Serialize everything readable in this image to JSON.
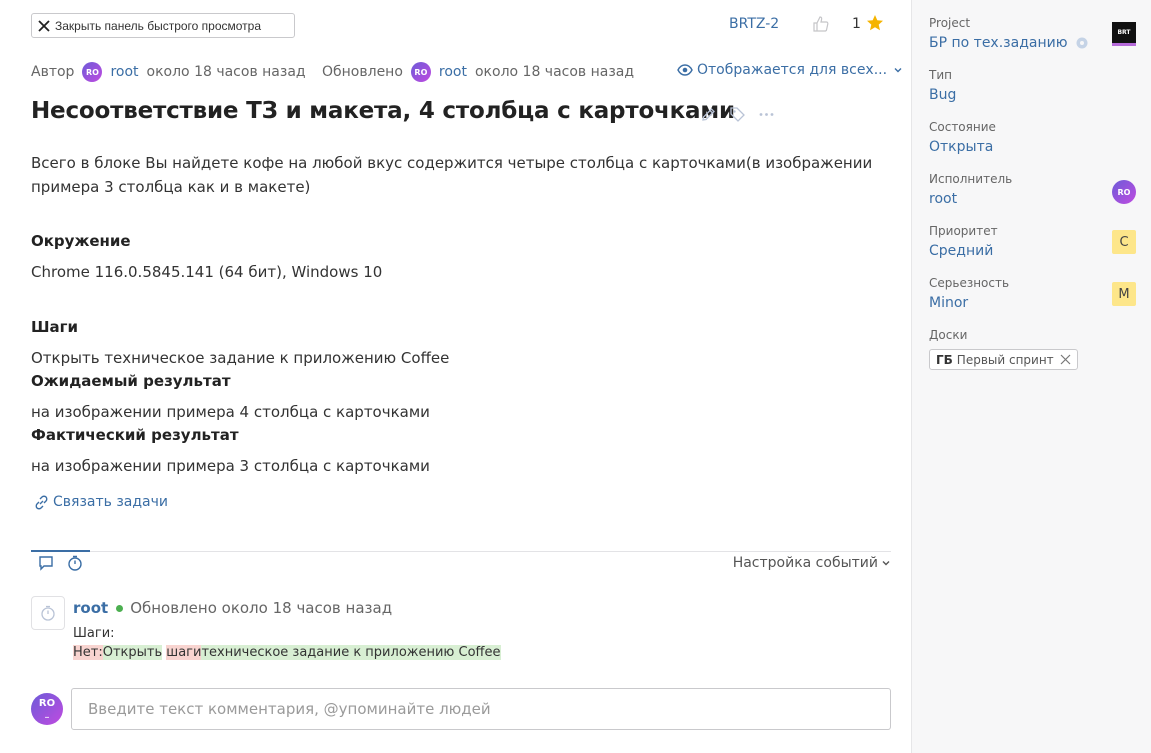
{
  "header": {
    "close_label": "Закрыть панель быстрого просмотра",
    "issue_key": "BRTZ-2",
    "favorites_count": "1"
  },
  "meta": {
    "author_label": "Автор",
    "author_avatar": "RO",
    "author_name": "root",
    "author_time": "около 18 часов назад",
    "updated_label": "Обновлено",
    "updated_avatar": "RO",
    "updated_name": "root",
    "updated_time": "около 18 часов назад",
    "visibility": "Отображается для всех..."
  },
  "issue": {
    "title": "Несоответствие ТЗ и макета, 4 столбца с карточками",
    "description": "Всего в блоке Вы найдете кофе на любой вкус содержится четыре столбца с карточками(в изображении примера 3 столбца как и в макете)",
    "env_heading": "Окружение",
    "env_text": "Chrome 116.0.5845.141 (64 бит), Windows 10",
    "steps_heading": "Шаги",
    "steps_text": "Открыть техническое задание к приложению Coffee",
    "expected_heading": "Ожидаемый результат",
    "expected_text": "на изображении примера 4 столбца с карточками",
    "actual_heading": "Фактический результат",
    "actual_text": "на изображении примера 3 столбца с карточками",
    "link_tasks": "Связать задачи"
  },
  "activity": {
    "events_settings": "Настройка событий",
    "event": {
      "user": "root",
      "text": "Обновлено около 18 часов назад",
      "field": "Шаги:",
      "diff_del_1": "Нет:",
      "diff_ins_1": "Открыть",
      "diff_plain": " ",
      "diff_del_2": "шаги",
      "diff_ins_2": "техническое задание к приложению Coffee"
    },
    "comment_avatar": "RO",
    "comment_placeholder": "Введите текст комментария, @упоминайте людей"
  },
  "sidebar": {
    "project_label": "Project",
    "project_value": "БР по тех.заданию",
    "project_logo": "BRT",
    "type_label": "Тип",
    "type_value": "Bug",
    "state_label": "Состояние",
    "state_value": "Открыта",
    "assignee_label": "Исполнитель",
    "assignee_value": "root",
    "assignee_avatar": "RO",
    "priority_label": "Приоритет",
    "priority_value": "Средний",
    "priority_badge": "C",
    "severity_label": "Серьезность",
    "severity_value": "Minor",
    "severity_badge": "M",
    "boards_label": "Доски",
    "board_code": "ГБ",
    "board_name": "Первый спринт"
  },
  "colors": {
    "link": "#3b6ea5",
    "accent_star": "#f5b400",
    "status_online": "#4caf50",
    "diff_deleted": "#f8d4d0",
    "diff_inserted": "#d8efd3"
  },
  "icons": [
    "close-icon",
    "thumbs-up-icon",
    "star-icon",
    "eye-icon",
    "chevron-down-icon",
    "pencil-icon",
    "tag-icon",
    "more-icon",
    "link-icon",
    "comment-icon",
    "history-icon",
    "gear-icon",
    "remove-icon"
  ]
}
